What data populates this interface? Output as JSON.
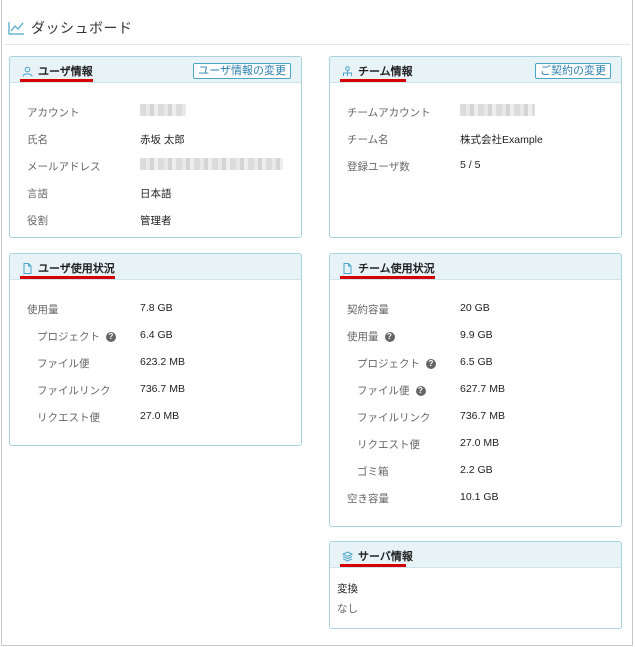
{
  "page": {
    "title": "ダッシュボード"
  },
  "user_info": {
    "title": "ユーザ情報",
    "button": "ユーザ情報の変更",
    "rows": [
      {
        "label": "アカウント",
        "value": ""
      },
      {
        "label": "氏名",
        "value": "赤坂 太郎"
      },
      {
        "label": "メールアドレス",
        "value": ""
      },
      {
        "label": "言語",
        "value": "日本語"
      },
      {
        "label": "役割",
        "value": "管理者"
      }
    ]
  },
  "team_info": {
    "title": "チーム情報",
    "button": "ご契約の変更",
    "rows": [
      {
        "label": "チームアカウント",
        "value": ""
      },
      {
        "label": "チーム名",
        "value": "株式会社Example"
      },
      {
        "label": "登録ユーザ数",
        "value": "5 / 5"
      }
    ]
  },
  "user_usage": {
    "title": "ユーザ使用状況",
    "rows": [
      {
        "label": "使用量",
        "value": "7.8 GB"
      },
      {
        "label": "プロジェクト",
        "value": "6.4 GB"
      },
      {
        "label": "ファイル便",
        "value": "623.2 MB"
      },
      {
        "label": "ファイルリンク",
        "value": "736.7 MB"
      },
      {
        "label": "リクエスト便",
        "value": "27.0 MB"
      }
    ]
  },
  "team_usage": {
    "title": "チーム使用状況",
    "rows": [
      {
        "label": "契約容量",
        "value": "20 GB"
      },
      {
        "label": "使用量",
        "value": "9.9 GB"
      },
      {
        "label": "プロジェクト",
        "value": "6.5 GB"
      },
      {
        "label": "ファイル便",
        "value": "627.7 MB"
      },
      {
        "label": "ファイルリンク",
        "value": "736.7 MB"
      },
      {
        "label": "リクエスト便",
        "value": "27.0 MB"
      },
      {
        "label": "ゴミ箱",
        "value": "2.2 GB"
      },
      {
        "label": "空き容量",
        "value": "10.1 GB"
      }
    ]
  },
  "server_info": {
    "title": "サーバ情報",
    "label": "変換",
    "value": "なし"
  },
  "help_glyph": "?",
  "colors": {
    "accent": "#2a7fb0",
    "panel_border": "#a9d1e0",
    "panel_head": "#e8f3f8",
    "highlight": "#d60000"
  }
}
